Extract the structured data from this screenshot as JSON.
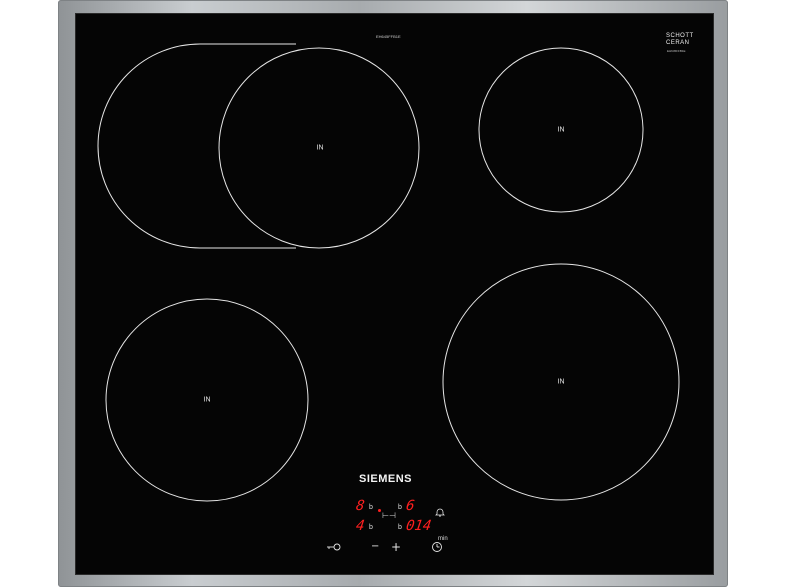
{
  "product": {
    "brand": "SIEMENS",
    "model_code": "EH645FFB1E",
    "glass_brand_line1": "SCHOTT",
    "glass_brand_line2": "CERAN",
    "glass_sub": "EH645FFB1E"
  },
  "zones": [
    {
      "name": "front-left-flex",
      "label": "IN"
    },
    {
      "name": "rear-right",
      "label": "IN"
    },
    {
      "name": "front-left",
      "label": "IN"
    },
    {
      "name": "front-right",
      "label": "IN"
    }
  ],
  "display": {
    "left_top_digit": "8",
    "left_bottom_digit": "4",
    "right_top_digit": "6",
    "timer_digits": "014",
    "b_label": "b",
    "timer_unit": "min"
  },
  "controls": {
    "minus_symbol": "−",
    "plus_symbol": "+"
  },
  "colors": {
    "glass": "#050505",
    "zone_line": "#e6e6e6",
    "display_red": "#ff1f1f",
    "frame_steel": "#b5b9bc"
  }
}
